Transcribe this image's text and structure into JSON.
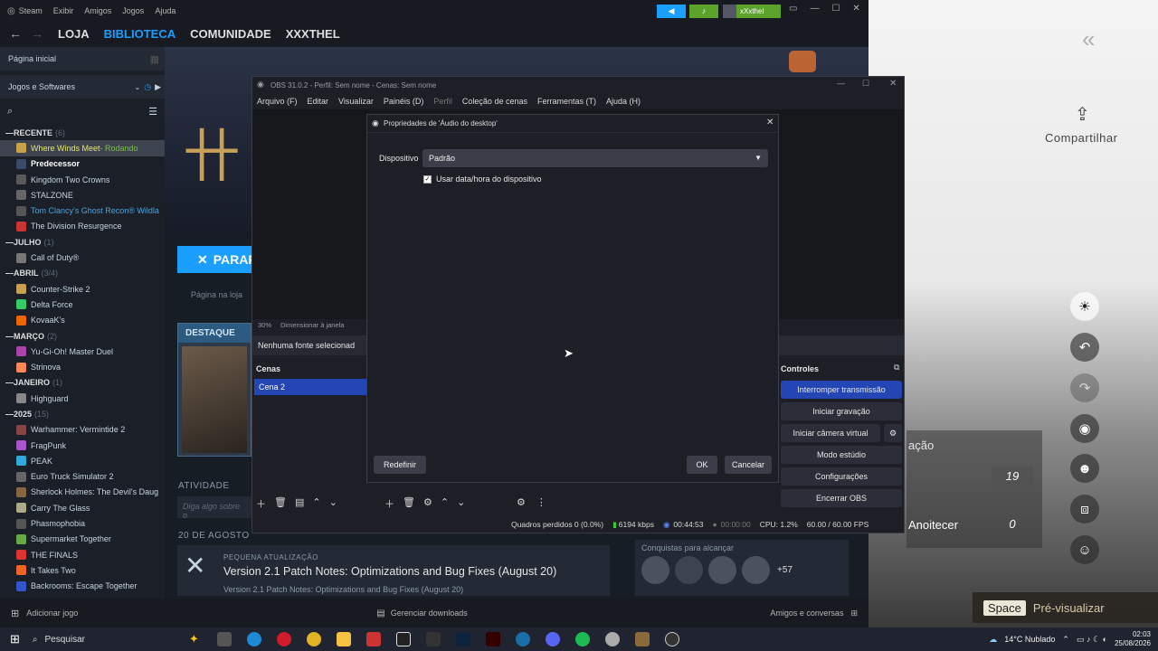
{
  "steam": {
    "menu": [
      "Steam",
      "Exibir",
      "Amigos",
      "Jogos",
      "Ajuda"
    ],
    "nav": {
      "store": "LOJA",
      "library": "BIBLIOTECA",
      "community": "COMUNIDADE",
      "user": "XXXTHEL"
    },
    "username": "xXxthel",
    "home_label": "Página inicial",
    "filter_label": "Jogos e Softwares",
    "sections": [
      {
        "name": "RECENTE",
        "count": "(6)",
        "items": [
          {
            "label": "Where Winds Meet",
            "suffix": " - Rodando",
            "state": "running",
            "color": "#c8a04a"
          },
          {
            "label": "Predecessor",
            "state": "bold",
            "color": "#3a4a6a"
          },
          {
            "label": "Kingdom Two Crowns",
            "state": "normal",
            "color": "#5a5a5a"
          },
          {
            "label": "STALZONE",
            "state": "normal",
            "color": "#666"
          },
          {
            "label": "Tom Clancy's Ghost Recon® Wildla",
            "state": "blue",
            "color": "#555"
          },
          {
            "label": "The Division Resurgence",
            "state": "normal",
            "color": "#c33"
          }
        ]
      },
      {
        "name": "JULHO",
        "count": "(1)",
        "items": [
          {
            "label": "Call of Duty®",
            "state": "normal",
            "color": "#777"
          }
        ]
      },
      {
        "name": "ABRIL",
        "count": "(3/4)",
        "items": [
          {
            "label": "Counter-Strike 2",
            "state": "normal",
            "color": "#c8a050"
          },
          {
            "label": "Delta Force",
            "state": "normal",
            "color": "#3c6"
          },
          {
            "label": "KovaaK's",
            "state": "normal",
            "color": "#e60"
          }
        ]
      },
      {
        "name": "MARÇO",
        "count": "(2)",
        "items": [
          {
            "label": "Yu-Gi-Oh! Master Duel",
            "state": "normal",
            "color": "#a4a"
          },
          {
            "label": "Strinova",
            "state": "normal",
            "color": "#f85"
          }
        ]
      },
      {
        "name": "JANEIRO",
        "count": "(1)",
        "items": [
          {
            "label": "Highguard",
            "state": "normal",
            "color": "#888"
          }
        ]
      },
      {
        "name": "2025",
        "count": "(15)",
        "items": [
          {
            "label": "Warhammer: Vermintide 2",
            "state": "normal",
            "color": "#844"
          },
          {
            "label": "FragPunk",
            "state": "normal",
            "color": "#a5c"
          },
          {
            "label": "PEAK",
            "state": "normal",
            "color": "#3ad"
          },
          {
            "label": "Euro Truck Simulator 2",
            "state": "normal",
            "color": "#666"
          },
          {
            "label": "Sherlock Holmes: The Devil's Daug",
            "state": "normal",
            "color": "#864"
          },
          {
            "label": "Carry The Glass",
            "state": "normal",
            "color": "#aa8"
          },
          {
            "label": "Phasmophobia",
            "state": "normal",
            "color": "#555"
          },
          {
            "label": "Supermarket Together",
            "state": "normal",
            "color": "#6a4"
          },
          {
            "label": "THE FINALS",
            "state": "normal",
            "color": "#d33"
          },
          {
            "label": "It Takes Two",
            "state": "normal",
            "color": "#e62"
          },
          {
            "label": "Backrooms: Escape Together",
            "state": "normal",
            "color": "#35c"
          }
        ]
      }
    ],
    "stop_button": "PARAR",
    "store_page": "Página na loja",
    "featured": "DESTAQUE",
    "activity": "ATIVIDADE",
    "activity_placeholder": "Diga algo sobre o",
    "date": "20 DE AGOSTO",
    "update_tag": "PEQUENA ATUALIZAÇÃO",
    "update_title": "Version 2.1 Patch Notes: Optimizations and Bug Fixes (August 20)",
    "update_sub": "Version 2.1 Patch Notes: Optimizations and Bug Fixes (August 20)",
    "achievements_label": "Conquistas para alcançar",
    "achievements_more": "+57",
    "add_game": "Adicionar jogo",
    "manage_downloads": "Gerenciar downloads",
    "friends_chat": "Amigos e conversas"
  },
  "obs": {
    "title": "OBS 31.0.2 - Perfil: Sem nome - Cenas: Sem nome",
    "menu": [
      "Arquivo (F)",
      "Editar",
      "Visualizar",
      "Painéis (D)",
      "Perfil",
      "Coleção de cenas",
      "Ferramentas (T)",
      "Ajuda (H)"
    ],
    "zoom": "30%",
    "resize_label": "Dimensionar à janela",
    "no_source": "Nenhuma fonte selecionad",
    "scenes_header": "Cenas",
    "scene_item": "Cena 2",
    "controls_header": "Controles",
    "controls": [
      "Interromper transmissão",
      "Iniciar gravação",
      "Iniciar câmera virtual",
      "Modo estúdio",
      "Configurações",
      "Encerrar OBS"
    ],
    "status": {
      "dropped": "Quadros perdidos 0 (0.0%)",
      "bitrate": "6194 kbps",
      "stream_time": "00:44:53",
      "rec_time": "00:00:00",
      "cpu": "CPU: 1.2%",
      "fps": "60.00 / 60.00 FPS"
    }
  },
  "dialog": {
    "title": "Propriedades de 'Áudio do desktop'",
    "device_label": "Dispositivo",
    "device_value": "Padrão",
    "checkbox_label": "Usar data/hora do dispositivo",
    "checkbox_checked": true,
    "reset": "Redefinir",
    "ok": "OK",
    "cancel": "Cancelar"
  },
  "game": {
    "share": "Compartilhar",
    "partial_text": "ação",
    "value1": "19",
    "night_label": "Anoitecer",
    "value2": "0",
    "space_key": "Space",
    "preview": "Pré-visualizar"
  },
  "taskbar": {
    "search": "Pesquisar",
    "weather": "14°C Nublado",
    "time": "02:03",
    "date": "25/08/2026"
  }
}
